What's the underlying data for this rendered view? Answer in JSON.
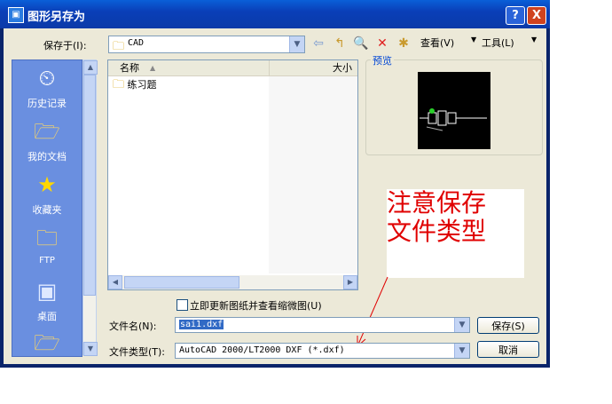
{
  "window": {
    "title": "图形另存为",
    "help_label": "?",
    "close_label": "X"
  },
  "save_in": {
    "label": "保存于(I):",
    "value": "CAD"
  },
  "toolbar": {
    "view_label": "查看(V)",
    "tools_label": "工具(L)"
  },
  "places": [
    {
      "label": "历史记录",
      "icon": "history-icon"
    },
    {
      "label": "我的文档",
      "icon": "my-documents-icon"
    },
    {
      "label": "收藏夹",
      "icon": "favorites-icon"
    },
    {
      "label": "FTP",
      "icon": "ftp-icon"
    },
    {
      "label": "桌面",
      "icon": "desktop-icon"
    }
  ],
  "file_list": {
    "columns": [
      {
        "label": "名称"
      },
      {
        "label": "大小"
      }
    ],
    "items": [
      {
        "name": "练习题",
        "icon": "folder-icon"
      }
    ]
  },
  "preview": {
    "label": "预览"
  },
  "update_thumbnail": {
    "label": "立即更新图纸并查看缩微图(U)"
  },
  "file_name": {
    "label": "文件名(N):",
    "value": "sai1.dxf"
  },
  "file_type": {
    "label": "文件类型(T):",
    "value": "AutoCAD 2000/LT2000 DXF (*.dxf)"
  },
  "buttons": {
    "save": "保存(S)",
    "cancel": "取消"
  },
  "annotation": {
    "line1": "注意保存",
    "line2": "文件类型",
    "color": "#e00000"
  }
}
